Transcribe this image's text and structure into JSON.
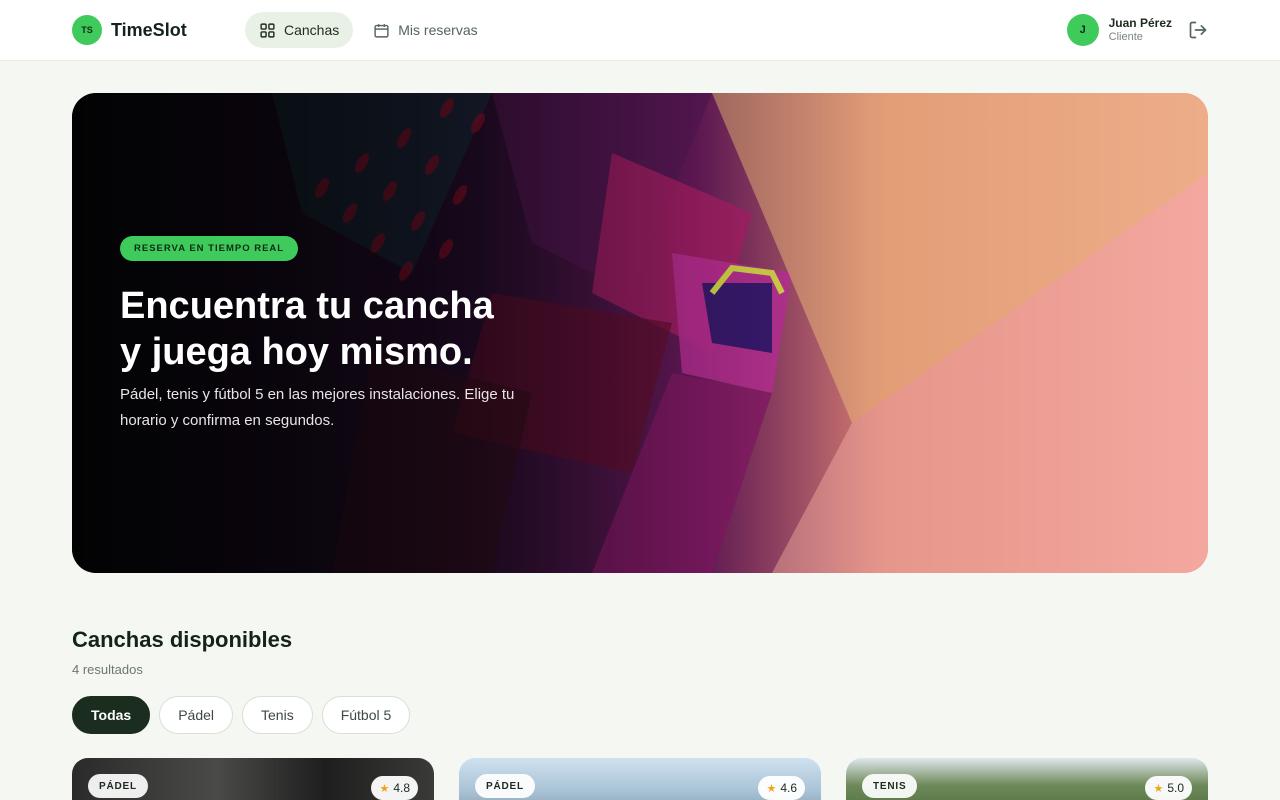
{
  "app": {
    "logo_initials": "TS",
    "name": "TimeSlot"
  },
  "nav": {
    "items": [
      {
        "label": "Canchas",
        "icon": "grid-icon",
        "active": true
      },
      {
        "label": "Mis reservas",
        "icon": "calendar-icon",
        "active": false
      }
    ]
  },
  "user": {
    "initial": "J",
    "name": "Juan Pérez",
    "role": "Cliente",
    "logout_icon": "logout-icon"
  },
  "hero": {
    "badge": "RESERVA EN TIEMPO REAL",
    "title_line1": "Encuentra tu cancha",
    "title_line2": "y juega hoy mismo.",
    "subtitle": "Pádel, tenis y fútbol 5 en las mejores instalaciones. Elige tu horario y confirma en segundos."
  },
  "section": {
    "title": "Canchas disponibles",
    "count": "4 resultados",
    "filters": [
      {
        "label": "Todas",
        "active": true
      },
      {
        "label": "Pádel",
        "active": false
      },
      {
        "label": "Tenis",
        "active": false
      },
      {
        "label": "Fútbol 5",
        "active": false
      }
    ]
  },
  "cards": [
    {
      "sport": "PÁDEL",
      "rating": "4.8"
    },
    {
      "sport": "PÁDEL",
      "rating": "4.6"
    },
    {
      "sport": "TENIS",
      "rating": "5.0"
    }
  ],
  "colors": {
    "accent": "#3fcb5c",
    "dark": "#1a2d1f",
    "background": "#f5f7f3",
    "star": "#f0a21b"
  }
}
